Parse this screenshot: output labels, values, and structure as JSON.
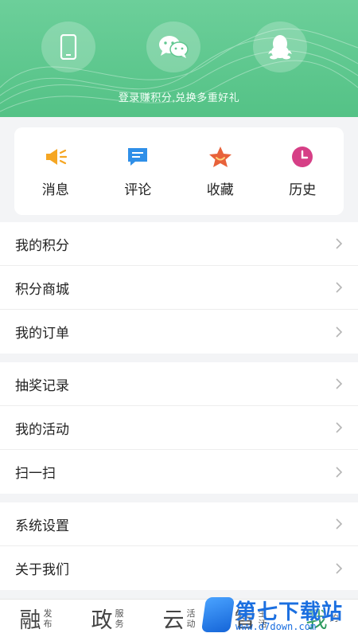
{
  "header": {
    "login_options": [
      {
        "icon": "phone-icon"
      },
      {
        "icon": "wechat-icon"
      },
      {
        "icon": "qq-icon"
      }
    ],
    "promo_text": "登录赚积分,兑换多重好礼",
    "colors": {
      "top": "#6ccf9a",
      "bottom": "#54c286"
    }
  },
  "shortcuts": [
    {
      "label": "消息",
      "icon": "megaphone-icon",
      "color": "#f5a623"
    },
    {
      "label": "评论",
      "icon": "comment-icon",
      "color": "#2f8fe8"
    },
    {
      "label": "收藏",
      "icon": "star-icon",
      "color": "#e8623a"
    },
    {
      "label": "历史",
      "icon": "clock-icon",
      "color": "#d63f86"
    }
  ],
  "menu": {
    "group1": [
      "我的积分",
      "积分商城",
      "我的订单"
    ],
    "group2": [
      "抽奖记录",
      "我的活动",
      "扫一扫"
    ],
    "group3": [
      "系统设置",
      "关于我们"
    ]
  },
  "tabbar": [
    {
      "big": "融",
      "small1": "发",
      "small2": "布"
    },
    {
      "big": "政",
      "small1": "服",
      "small2": "务"
    },
    {
      "big": "云",
      "small1": "活",
      "small2": "动"
    },
    {
      "big": "智",
      "small1": "生",
      "small2": "活"
    },
    {
      "big": "我",
      "small1": "的",
      "small2": ""
    }
  ],
  "watermark": {
    "text": "第七下载站",
    "url": "www.d7down.com"
  }
}
